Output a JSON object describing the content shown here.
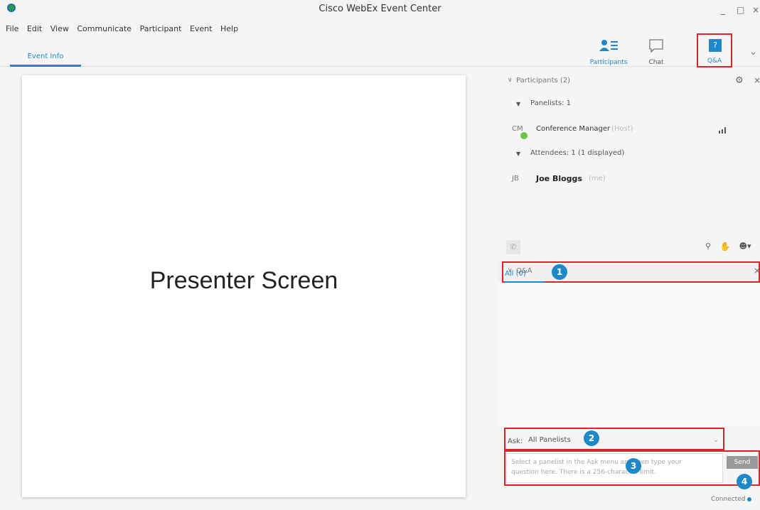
{
  "window": {
    "title": "Cisco WebEx Event Center",
    "minimize": "_",
    "maximize": "□",
    "close": "×"
  },
  "menu": [
    "File",
    "Edit",
    "View",
    "Communicate",
    "Participant",
    "Event",
    "Help"
  ],
  "tabs": {
    "event_info": "Event Info"
  },
  "panel_buttons": {
    "participants": "Participants",
    "chat": "Chat",
    "qa": "Q&A",
    "qa_glyph": "?",
    "more": "⌄"
  },
  "presenter": {
    "label": "Presenter Screen"
  },
  "participants": {
    "header": "Participants (2)",
    "panelists_group": "Panelists: 1",
    "host": {
      "initials": "CM",
      "name": "Conference Manager",
      "role": "(Host)"
    },
    "attendees_group": "Attendees: 1 (1 displayed)",
    "attendee": {
      "initials": "JB",
      "name": "Joe Bloggs",
      "role": "(me)"
    }
  },
  "qa": {
    "header": "Q&A",
    "tab_all": "All (0)",
    "ask_label": "Ask:",
    "ask_value": "All Panelists",
    "input_placeholder_line1": "Select a panelist in the Ask menu and then type your",
    "input_placeholder_line2": "question here. There is a 256-character limit.",
    "send_label": "Send",
    "status": "Connected"
  },
  "callouts": {
    "one": "1",
    "two": "2",
    "three": "3",
    "four": "4"
  },
  "colors": {
    "accent": "#1e88c8",
    "callout": "#d9262c",
    "presence": "#6cc644"
  },
  "icons": [
    "participants-icon",
    "chat-icon",
    "qa-icon",
    "gear-icon",
    "close-icon",
    "phone-icon",
    "raise-hand-icon",
    "emoticon-icon"
  ]
}
